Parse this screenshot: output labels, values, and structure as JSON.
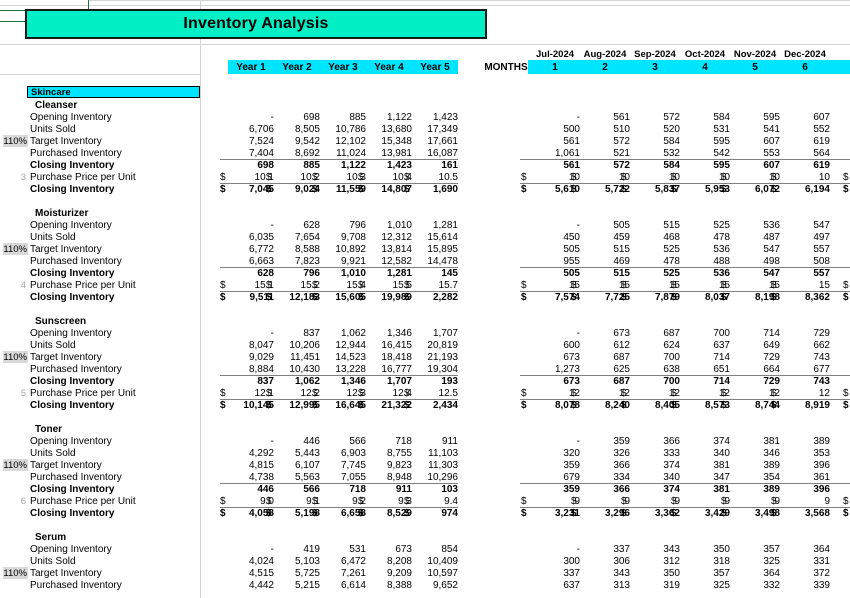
{
  "title": "Inventory Analysis",
  "colors": {
    "title_fill": "#00EFC4",
    "header_fill": "#00E5FF",
    "category_fill": "#00E5FF",
    "pct_fill": "#D9D9D9",
    "selection_border": "#217346"
  },
  "header": {
    "year_labels": [
      "Year 1",
      "Year 2",
      "Year 3",
      "Year 4",
      "Year 5"
    ],
    "months_label": "MONTHS",
    "month_dates": [
      "Jul-2024",
      "Aug-2024",
      "Sep-2024",
      "Oct-2024",
      "Nov-2024",
      "Dec-2024"
    ],
    "month_numbers": [
      "1",
      "2",
      "3",
      "4",
      "5",
      "6"
    ]
  },
  "category": "Skincare",
  "row_labels": {
    "opening": "Opening Inventory",
    "units_sold": "Units Sold",
    "target": "Target Inventory",
    "purchased": "Purchased Inventory",
    "closing": "Closing Inventory",
    "price": "Purchase Price per Unit",
    "closing_value": "Closing Inventory",
    "target_pct": "110%"
  },
  "products": [
    {
      "name": "Cleanser",
      "row_number": "3",
      "years": {
        "opening": [
          "-",
          "698",
          "885",
          "1,122",
          "1,423"
        ],
        "units_sold": [
          "6,706",
          "8,505",
          "10,786",
          "13,680",
          "17,349"
        ],
        "target": [
          "7,524",
          "9,542",
          "12,102",
          "15,348",
          "17,661"
        ],
        "purchased": [
          "7,404",
          "8,692",
          "11,024",
          "13,981",
          "16,087"
        ],
        "closing": [
          "698",
          "885",
          "1,122",
          "1,423",
          "161"
        ],
        "price": [
          "10.1",
          "10.2",
          "10.3",
          "10.4",
          "10.5"
        ],
        "closing_value": [
          "7,045",
          "9,024",
          "11,559",
          "14,807",
          "1,690"
        ]
      },
      "months": {
        "opening": [
          "-",
          "561",
          "572",
          "584",
          "595",
          "607"
        ],
        "units_sold": [
          "500",
          "510",
          "520",
          "531",
          "541",
          "552"
        ],
        "target": [
          "561",
          "572",
          "584",
          "595",
          "607",
          "619"
        ],
        "purchased": [
          "1,061",
          "521",
          "532",
          "542",
          "553",
          "564"
        ],
        "closing": [
          "561",
          "572",
          "584",
          "595",
          "607",
          "619"
        ],
        "price": [
          "10",
          "10",
          "10",
          "10",
          "10",
          "10"
        ],
        "closing_value": [
          "5,610",
          "5,722",
          "5,837",
          "5,953",
          "6,072",
          "6,194"
        ]
      }
    },
    {
      "name": "Moisturizer",
      "row_number": "4",
      "years": {
        "opening": [
          "-",
          "628",
          "796",
          "1,010",
          "1,281"
        ],
        "units_sold": [
          "6,035",
          "7,654",
          "9,708",
          "12,312",
          "15,614"
        ],
        "target": [
          "6,772",
          "8,588",
          "10,892",
          "13,814",
          "15,895"
        ],
        "purchased": [
          "6,663",
          "7,823",
          "9,921",
          "12,582",
          "14,478"
        ],
        "closing": [
          "628",
          "796",
          "1,010",
          "1,281",
          "145"
        ],
        "price": [
          "15.1",
          "15.2",
          "15.4",
          "15.5",
          "15.7"
        ],
        "closing_value": [
          "9,511",
          "12,183",
          "15,605",
          "19,989",
          "2,282"
        ]
      },
      "months": {
        "opening": [
          "-",
          "505",
          "515",
          "525",
          "536",
          "547"
        ],
        "units_sold": [
          "450",
          "459",
          "468",
          "478",
          "487",
          "497"
        ],
        "target": [
          "505",
          "515",
          "525",
          "536",
          "547",
          "557"
        ],
        "purchased": [
          "955",
          "469",
          "478",
          "488",
          "498",
          "508"
        ],
        "closing": [
          "505",
          "515",
          "525",
          "536",
          "547",
          "557"
        ],
        "price": [
          "15",
          "15",
          "15",
          "15",
          "15",
          "15"
        ],
        "closing_value": [
          "7,574",
          "7,725",
          "7,879",
          "8,037",
          "8,198",
          "8,362"
        ]
      }
    },
    {
      "name": "Sunscreen",
      "row_number": "5",
      "years": {
        "opening": [
          "-",
          "837",
          "1,062",
          "1,346",
          "1,707"
        ],
        "units_sold": [
          "8,047",
          "10,206",
          "12,944",
          "16,415",
          "20,819"
        ],
        "target": [
          "9,029",
          "11,451",
          "14,523",
          "18,418",
          "21,193"
        ],
        "purchased": [
          "8,884",
          "10,430",
          "13,228",
          "16,777",
          "19,304"
        ],
        "closing": [
          "837",
          "1,062",
          "1,346",
          "1,707",
          "193"
        ],
        "price": [
          "12.1",
          "12.2",
          "12.3",
          "12.4",
          "12.5"
        ],
        "closing_value": [
          "10,145",
          "12,995",
          "16,645",
          "21,322",
          "2,434"
        ]
      },
      "months": {
        "opening": [
          "-",
          "673",
          "687",
          "700",
          "714",
          "729"
        ],
        "units_sold": [
          "600",
          "612",
          "624",
          "637",
          "649",
          "662"
        ],
        "target": [
          "673",
          "687",
          "700",
          "714",
          "729",
          "743"
        ],
        "purchased": [
          "1,273",
          "625",
          "638",
          "651",
          "664",
          "677"
        ],
        "closing": [
          "673",
          "687",
          "700",
          "714",
          "729",
          "743"
        ],
        "price": [
          "12",
          "12",
          "12",
          "12",
          "12",
          "12"
        ],
        "closing_value": [
          "8,078",
          "8,240",
          "8,405",
          "8,573",
          "8,744",
          "8,919"
        ]
      }
    },
    {
      "name": "Toner",
      "row_number": "6",
      "years": {
        "opening": [
          "-",
          "446",
          "566",
          "718",
          "911"
        ],
        "units_sold": [
          "4,292",
          "5,443",
          "6,903",
          "8,755",
          "11,103"
        ],
        "target": [
          "4,815",
          "6,107",
          "7,745",
          "9,823",
          "11,303"
        ],
        "purchased": [
          "4,738",
          "5,563",
          "7,055",
          "8,948",
          "10,296"
        ],
        "closing": [
          "446",
          "566",
          "718",
          "911",
          "103"
        ],
        "price": [
          "9.0",
          "9.1",
          "9.2",
          "9.3",
          "9.4"
        ],
        "closing_value": [
          "4,058",
          "5,198",
          "6,658",
          "8,529",
          "974"
        ]
      },
      "months": {
        "opening": [
          "-",
          "359",
          "366",
          "374",
          "381",
          "389"
        ],
        "units_sold": [
          "320",
          "326",
          "333",
          "340",
          "346",
          "353"
        ],
        "target": [
          "359",
          "366",
          "374",
          "381",
          "389",
          "396"
        ],
        "purchased": [
          "679",
          "334",
          "340",
          "347",
          "354",
          "361"
        ],
        "closing": [
          "359",
          "366",
          "374",
          "381",
          "389",
          "396"
        ],
        "price": [
          "9",
          "9",
          "9",
          "9",
          "9",
          "9"
        ],
        "closing_value": [
          "3,231",
          "3,296",
          "3,362",
          "3,429",
          "3,498",
          "3,568"
        ]
      }
    },
    {
      "name": "Serum",
      "row_number": "",
      "years": {
        "opening": [
          "-",
          "419",
          "531",
          "673",
          "854"
        ],
        "units_sold": [
          "4,024",
          "5,103",
          "6,472",
          "8,208",
          "10,409"
        ],
        "target": [
          "4,515",
          "5,725",
          "7,261",
          "9,209",
          "10,597"
        ],
        "purchased": [
          "4,442",
          "5,215",
          "6,614",
          "8,388",
          "9,652"
        ]
      },
      "months": {
        "opening": [
          "-",
          "337",
          "343",
          "350",
          "357",
          "364"
        ],
        "units_sold": [
          "300",
          "306",
          "312",
          "318",
          "325",
          "331"
        ],
        "target": [
          "337",
          "343",
          "350",
          "357",
          "364",
          "372"
        ],
        "purchased": [
          "637",
          "313",
          "319",
          "325",
          "332",
          "339"
        ]
      }
    }
  ],
  "currency_symbol": "$"
}
